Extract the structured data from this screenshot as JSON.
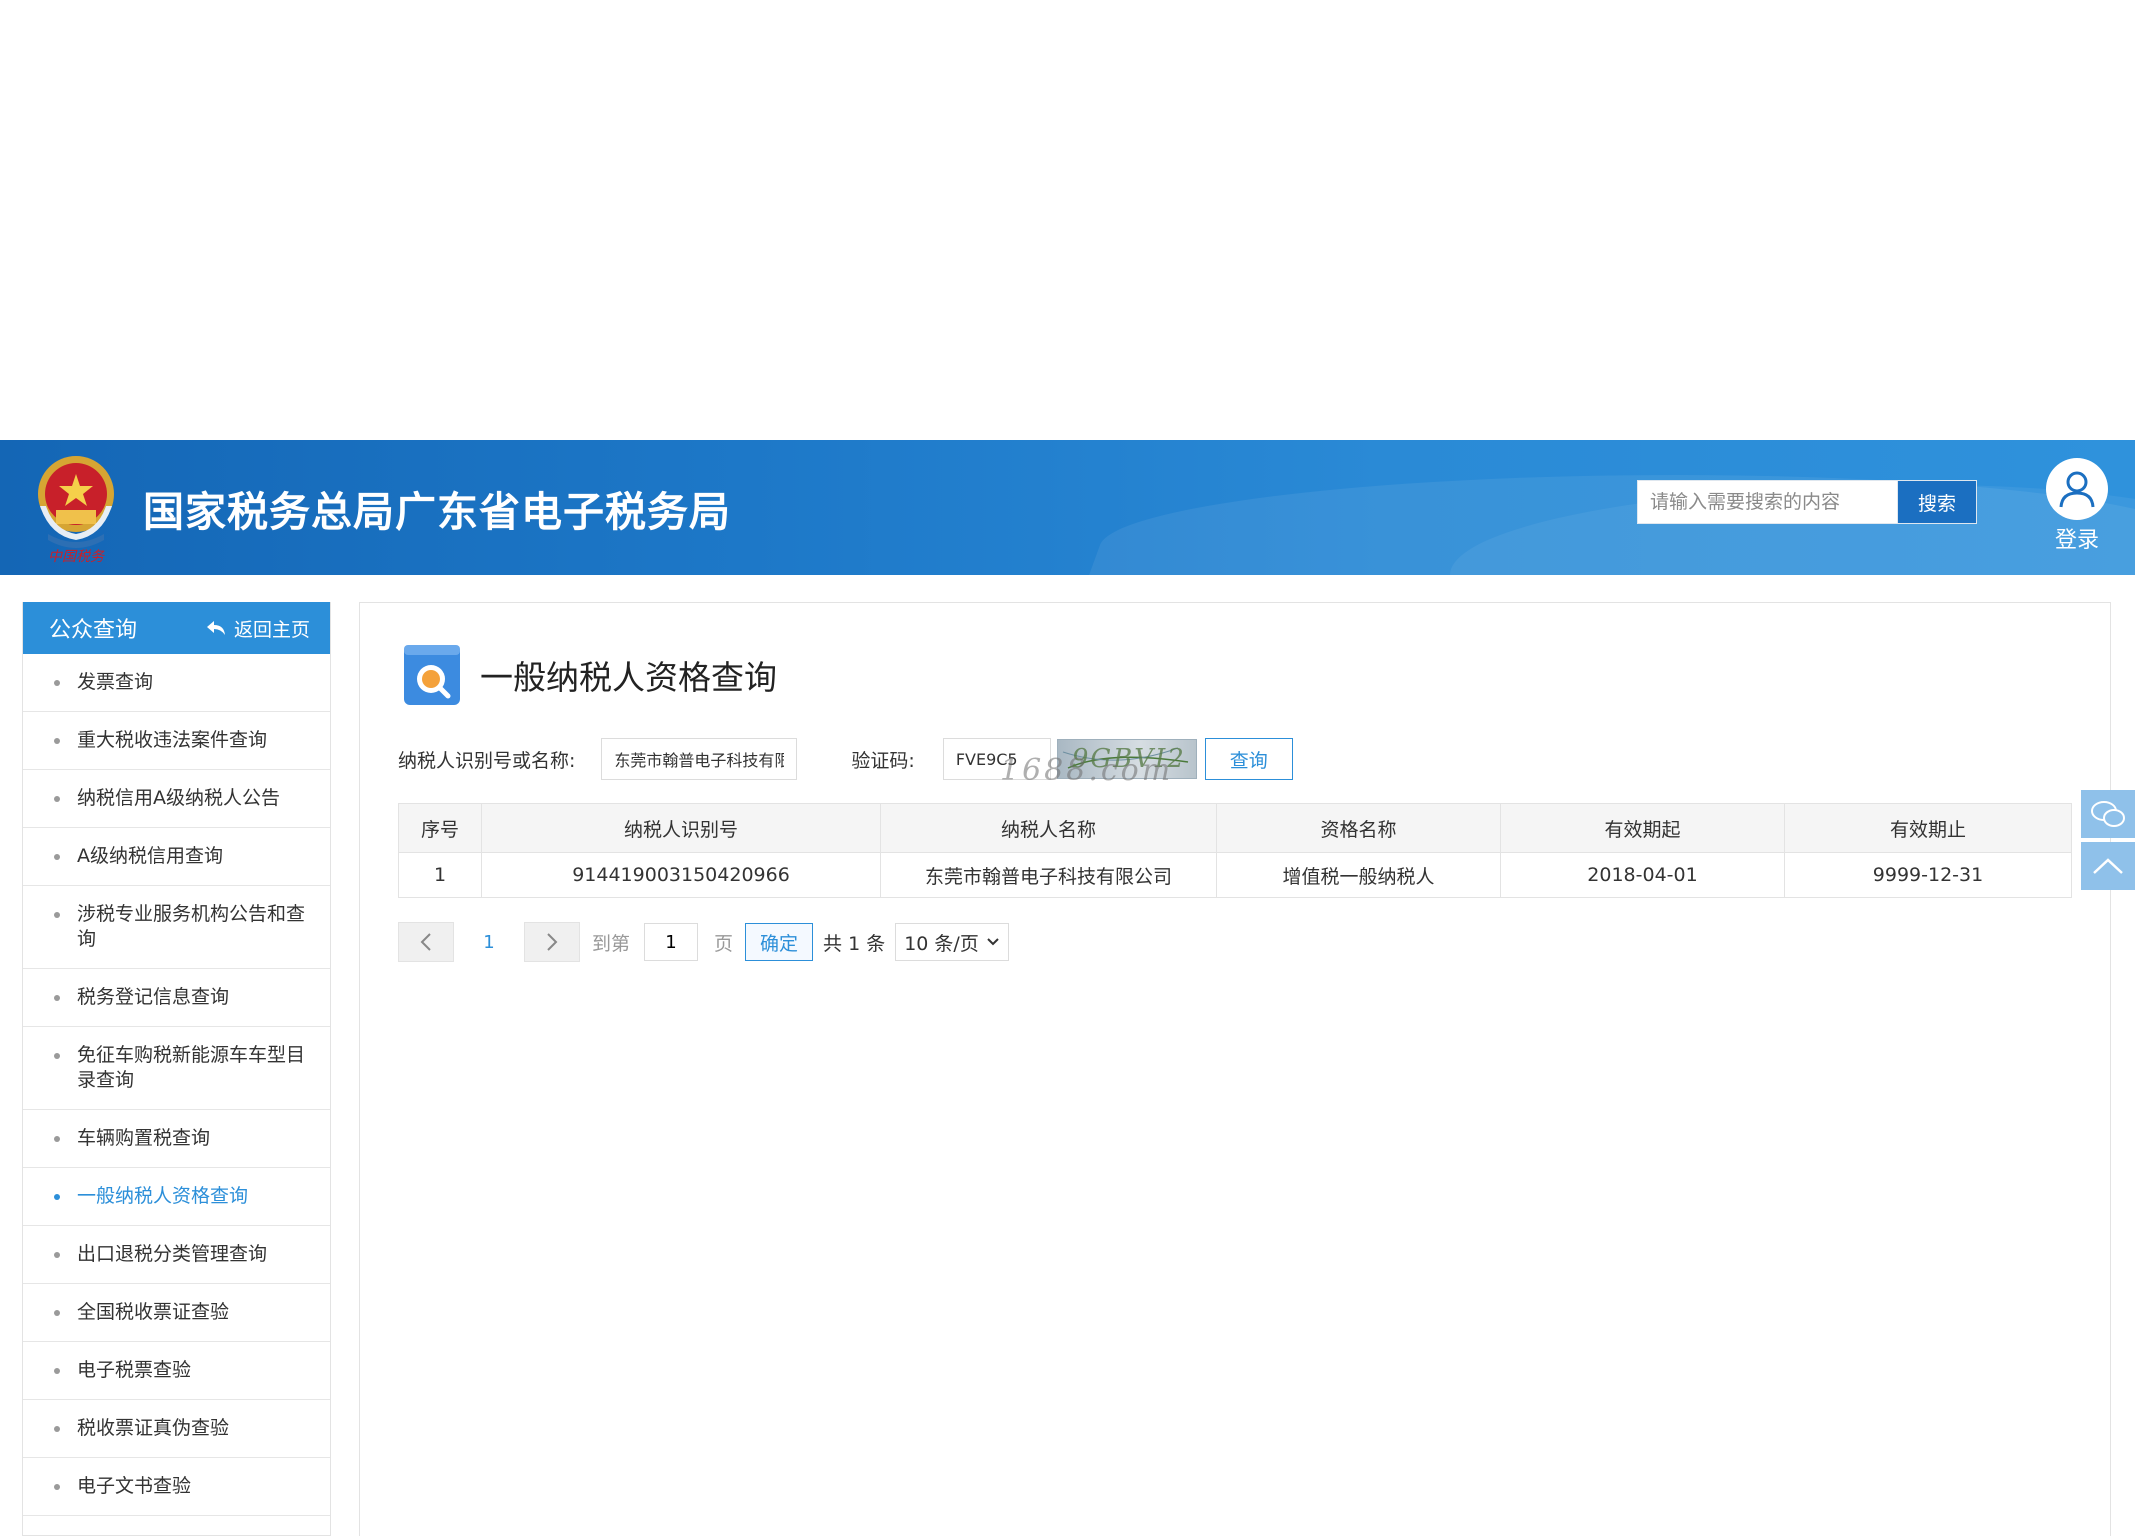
{
  "header": {
    "site_title": "国家税务总局广东省电子税务局",
    "search_placeholder": "请输入需要搜索的内容",
    "search_button": "搜索",
    "login_label": "登录",
    "emblem_script": "中国税务",
    "colors": {
      "banner": "#1d78c8",
      "accent": "#2c8fd9"
    }
  },
  "sidebar": {
    "title": "公众查询",
    "back_label": "返回主页",
    "items": [
      {
        "label": "发票查询"
      },
      {
        "label": "重大税收违法案件查询"
      },
      {
        "label": "纳税信用A级纳税人公告"
      },
      {
        "label": "A级纳税信用查询"
      },
      {
        "label": "涉税专业服务机构公告和查询"
      },
      {
        "label": "税务登记信息查询"
      },
      {
        "label": "免征车购税新能源车车型目录查询"
      },
      {
        "label": "车辆购置税查询"
      },
      {
        "label": "一般纳税人资格查询",
        "active": true
      },
      {
        "label": "出口退税分类管理查询"
      },
      {
        "label": "全国税收票证查验"
      },
      {
        "label": "电子税票查验"
      },
      {
        "label": "税收票证真伪查验"
      },
      {
        "label": "电子文书查验"
      }
    ]
  },
  "main": {
    "page_title": "一般纳税人资格查询",
    "form": {
      "name_label": "纳税人识别号或名称:",
      "name_value": "东莞市翰普电子科技有限公司",
      "code_label": "验证码:",
      "code_value": "FVE9C5",
      "captcha_text": "9GBVI2",
      "query_button": "查询"
    },
    "watermark": "1688.com",
    "table": {
      "headers": [
        "序号",
        "纳税人识别号",
        "纳税人名称",
        "资格名称",
        "有效期起",
        "有效期止"
      ],
      "rows": [
        [
          "1",
          "914419003150420966",
          "东莞市翰普电子科技有限公司",
          "增值税一般纳税人",
          "2018-04-01",
          "9999-12-31"
        ]
      ]
    },
    "pagination": {
      "prev_icon": "chevron-left-icon",
      "current_page": "1",
      "next_icon": "chevron-right-icon",
      "goto_label": "到第",
      "goto_value": "1",
      "page_suffix": "页",
      "confirm_button": "确定",
      "total_text": "共 1 条",
      "page_size": "10 条/页"
    }
  },
  "float_tools": {
    "wechat_icon": "wechat-icon",
    "top_icon": "back-to-top-icon"
  }
}
